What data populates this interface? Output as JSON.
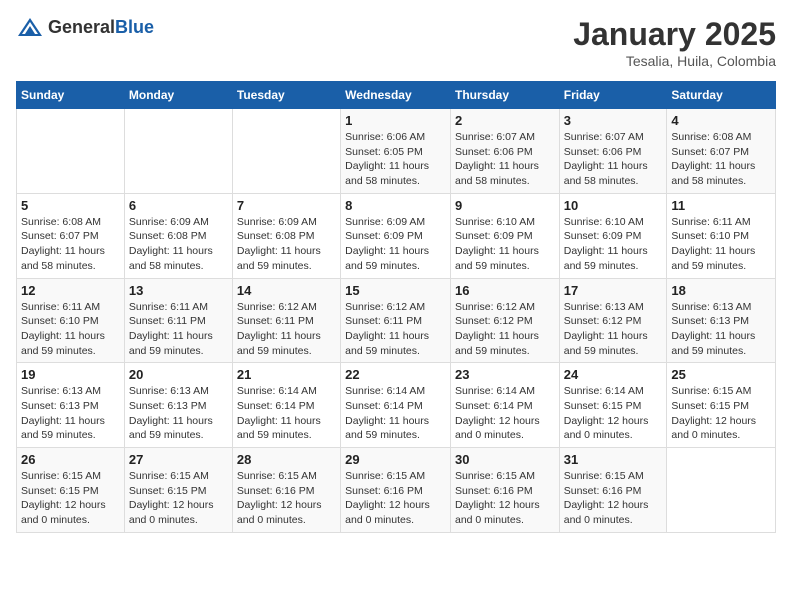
{
  "header": {
    "logo_general": "General",
    "logo_blue": "Blue",
    "month": "January 2025",
    "location": "Tesalia, Huila, Colombia"
  },
  "weekdays": [
    "Sunday",
    "Monday",
    "Tuesday",
    "Wednesday",
    "Thursday",
    "Friday",
    "Saturday"
  ],
  "weeks": [
    [
      {
        "day": "",
        "sunrise": "",
        "sunset": "",
        "daylight": ""
      },
      {
        "day": "",
        "sunrise": "",
        "sunset": "",
        "daylight": ""
      },
      {
        "day": "",
        "sunrise": "",
        "sunset": "",
        "daylight": ""
      },
      {
        "day": "1",
        "sunrise": "Sunrise: 6:06 AM",
        "sunset": "Sunset: 6:05 PM",
        "daylight": "Daylight: 11 hours and 58 minutes."
      },
      {
        "day": "2",
        "sunrise": "Sunrise: 6:07 AM",
        "sunset": "Sunset: 6:06 PM",
        "daylight": "Daylight: 11 hours and 58 minutes."
      },
      {
        "day": "3",
        "sunrise": "Sunrise: 6:07 AM",
        "sunset": "Sunset: 6:06 PM",
        "daylight": "Daylight: 11 hours and 58 minutes."
      },
      {
        "day": "4",
        "sunrise": "Sunrise: 6:08 AM",
        "sunset": "Sunset: 6:07 PM",
        "daylight": "Daylight: 11 hours and 58 minutes."
      }
    ],
    [
      {
        "day": "5",
        "sunrise": "Sunrise: 6:08 AM",
        "sunset": "Sunset: 6:07 PM",
        "daylight": "Daylight: 11 hours and 58 minutes."
      },
      {
        "day": "6",
        "sunrise": "Sunrise: 6:09 AM",
        "sunset": "Sunset: 6:08 PM",
        "daylight": "Daylight: 11 hours and 58 minutes."
      },
      {
        "day": "7",
        "sunrise": "Sunrise: 6:09 AM",
        "sunset": "Sunset: 6:08 PM",
        "daylight": "Daylight: 11 hours and 59 minutes."
      },
      {
        "day": "8",
        "sunrise": "Sunrise: 6:09 AM",
        "sunset": "Sunset: 6:09 PM",
        "daylight": "Daylight: 11 hours and 59 minutes."
      },
      {
        "day": "9",
        "sunrise": "Sunrise: 6:10 AM",
        "sunset": "Sunset: 6:09 PM",
        "daylight": "Daylight: 11 hours and 59 minutes."
      },
      {
        "day": "10",
        "sunrise": "Sunrise: 6:10 AM",
        "sunset": "Sunset: 6:09 PM",
        "daylight": "Daylight: 11 hours and 59 minutes."
      },
      {
        "day": "11",
        "sunrise": "Sunrise: 6:11 AM",
        "sunset": "Sunset: 6:10 PM",
        "daylight": "Daylight: 11 hours and 59 minutes."
      }
    ],
    [
      {
        "day": "12",
        "sunrise": "Sunrise: 6:11 AM",
        "sunset": "Sunset: 6:10 PM",
        "daylight": "Daylight: 11 hours and 59 minutes."
      },
      {
        "day": "13",
        "sunrise": "Sunrise: 6:11 AM",
        "sunset": "Sunset: 6:11 PM",
        "daylight": "Daylight: 11 hours and 59 minutes."
      },
      {
        "day": "14",
        "sunrise": "Sunrise: 6:12 AM",
        "sunset": "Sunset: 6:11 PM",
        "daylight": "Daylight: 11 hours and 59 minutes."
      },
      {
        "day": "15",
        "sunrise": "Sunrise: 6:12 AM",
        "sunset": "Sunset: 6:11 PM",
        "daylight": "Daylight: 11 hours and 59 minutes."
      },
      {
        "day": "16",
        "sunrise": "Sunrise: 6:12 AM",
        "sunset": "Sunset: 6:12 PM",
        "daylight": "Daylight: 11 hours and 59 minutes."
      },
      {
        "day": "17",
        "sunrise": "Sunrise: 6:13 AM",
        "sunset": "Sunset: 6:12 PM",
        "daylight": "Daylight: 11 hours and 59 minutes."
      },
      {
        "day": "18",
        "sunrise": "Sunrise: 6:13 AM",
        "sunset": "Sunset: 6:13 PM",
        "daylight": "Daylight: 11 hours and 59 minutes."
      }
    ],
    [
      {
        "day": "19",
        "sunrise": "Sunrise: 6:13 AM",
        "sunset": "Sunset: 6:13 PM",
        "daylight": "Daylight: 11 hours and 59 minutes."
      },
      {
        "day": "20",
        "sunrise": "Sunrise: 6:13 AM",
        "sunset": "Sunset: 6:13 PM",
        "daylight": "Daylight: 11 hours and 59 minutes."
      },
      {
        "day": "21",
        "sunrise": "Sunrise: 6:14 AM",
        "sunset": "Sunset: 6:14 PM",
        "daylight": "Daylight: 11 hours and 59 minutes."
      },
      {
        "day": "22",
        "sunrise": "Sunrise: 6:14 AM",
        "sunset": "Sunset: 6:14 PM",
        "daylight": "Daylight: 11 hours and 59 minutes."
      },
      {
        "day": "23",
        "sunrise": "Sunrise: 6:14 AM",
        "sunset": "Sunset: 6:14 PM",
        "daylight": "Daylight: 12 hours and 0 minutes."
      },
      {
        "day": "24",
        "sunrise": "Sunrise: 6:14 AM",
        "sunset": "Sunset: 6:15 PM",
        "daylight": "Daylight: 12 hours and 0 minutes."
      },
      {
        "day": "25",
        "sunrise": "Sunrise: 6:15 AM",
        "sunset": "Sunset: 6:15 PM",
        "daylight": "Daylight: 12 hours and 0 minutes."
      }
    ],
    [
      {
        "day": "26",
        "sunrise": "Sunrise: 6:15 AM",
        "sunset": "Sunset: 6:15 PM",
        "daylight": "Daylight: 12 hours and 0 minutes."
      },
      {
        "day": "27",
        "sunrise": "Sunrise: 6:15 AM",
        "sunset": "Sunset: 6:15 PM",
        "daylight": "Daylight: 12 hours and 0 minutes."
      },
      {
        "day": "28",
        "sunrise": "Sunrise: 6:15 AM",
        "sunset": "Sunset: 6:16 PM",
        "daylight": "Daylight: 12 hours and 0 minutes."
      },
      {
        "day": "29",
        "sunrise": "Sunrise: 6:15 AM",
        "sunset": "Sunset: 6:16 PM",
        "daylight": "Daylight: 12 hours and 0 minutes."
      },
      {
        "day": "30",
        "sunrise": "Sunrise: 6:15 AM",
        "sunset": "Sunset: 6:16 PM",
        "daylight": "Daylight: 12 hours and 0 minutes."
      },
      {
        "day": "31",
        "sunrise": "Sunrise: 6:15 AM",
        "sunset": "Sunset: 6:16 PM",
        "daylight": "Daylight: 12 hours and 0 minutes."
      },
      {
        "day": "",
        "sunrise": "",
        "sunset": "",
        "daylight": ""
      }
    ]
  ]
}
